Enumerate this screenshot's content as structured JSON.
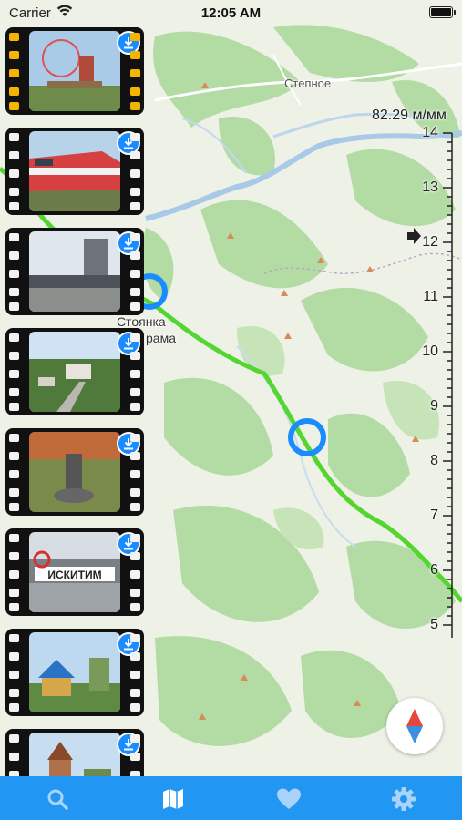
{
  "status_bar": {
    "carrier": "Carrier",
    "time": "12:05 AM"
  },
  "map": {
    "scale_label": "82.29 м/мм",
    "ruler_numbers": [
      "14",
      "13",
      "12",
      "11",
      "10",
      "9",
      "8",
      "7",
      "6",
      "5"
    ],
    "place_label": "Степное",
    "stop_label_line1": "Стоянка",
    "stop_label_line2": "рама",
    "colors": {
      "route": "#53d62f",
      "stop_ring": "#1a8cff",
      "land": "#eef1e6",
      "forest": "#aed8a0",
      "river": "#a8c9e8"
    }
  },
  "film_items": [
    {
      "name": "amusement-park-photo",
      "frame": "gold"
    },
    {
      "name": "train-photo",
      "frame": "white"
    },
    {
      "name": "bridge-photo",
      "frame": "white"
    },
    {
      "name": "town-aerial-photo",
      "frame": "white"
    },
    {
      "name": "statue-photo",
      "frame": "white"
    },
    {
      "name": "iskitim-sign-photo",
      "frame": "white",
      "sign_text": "ИСКИТИМ"
    },
    {
      "name": "chapel-photo",
      "frame": "white"
    },
    {
      "name": "church-photo",
      "frame": "white"
    }
  ],
  "tab_bar": {
    "tabs": [
      {
        "icon": "search-icon",
        "active": false
      },
      {
        "icon": "map-icon",
        "active": true
      },
      {
        "icon": "heart-icon",
        "active": false
      },
      {
        "icon": "gear-icon",
        "active": false
      }
    ]
  }
}
